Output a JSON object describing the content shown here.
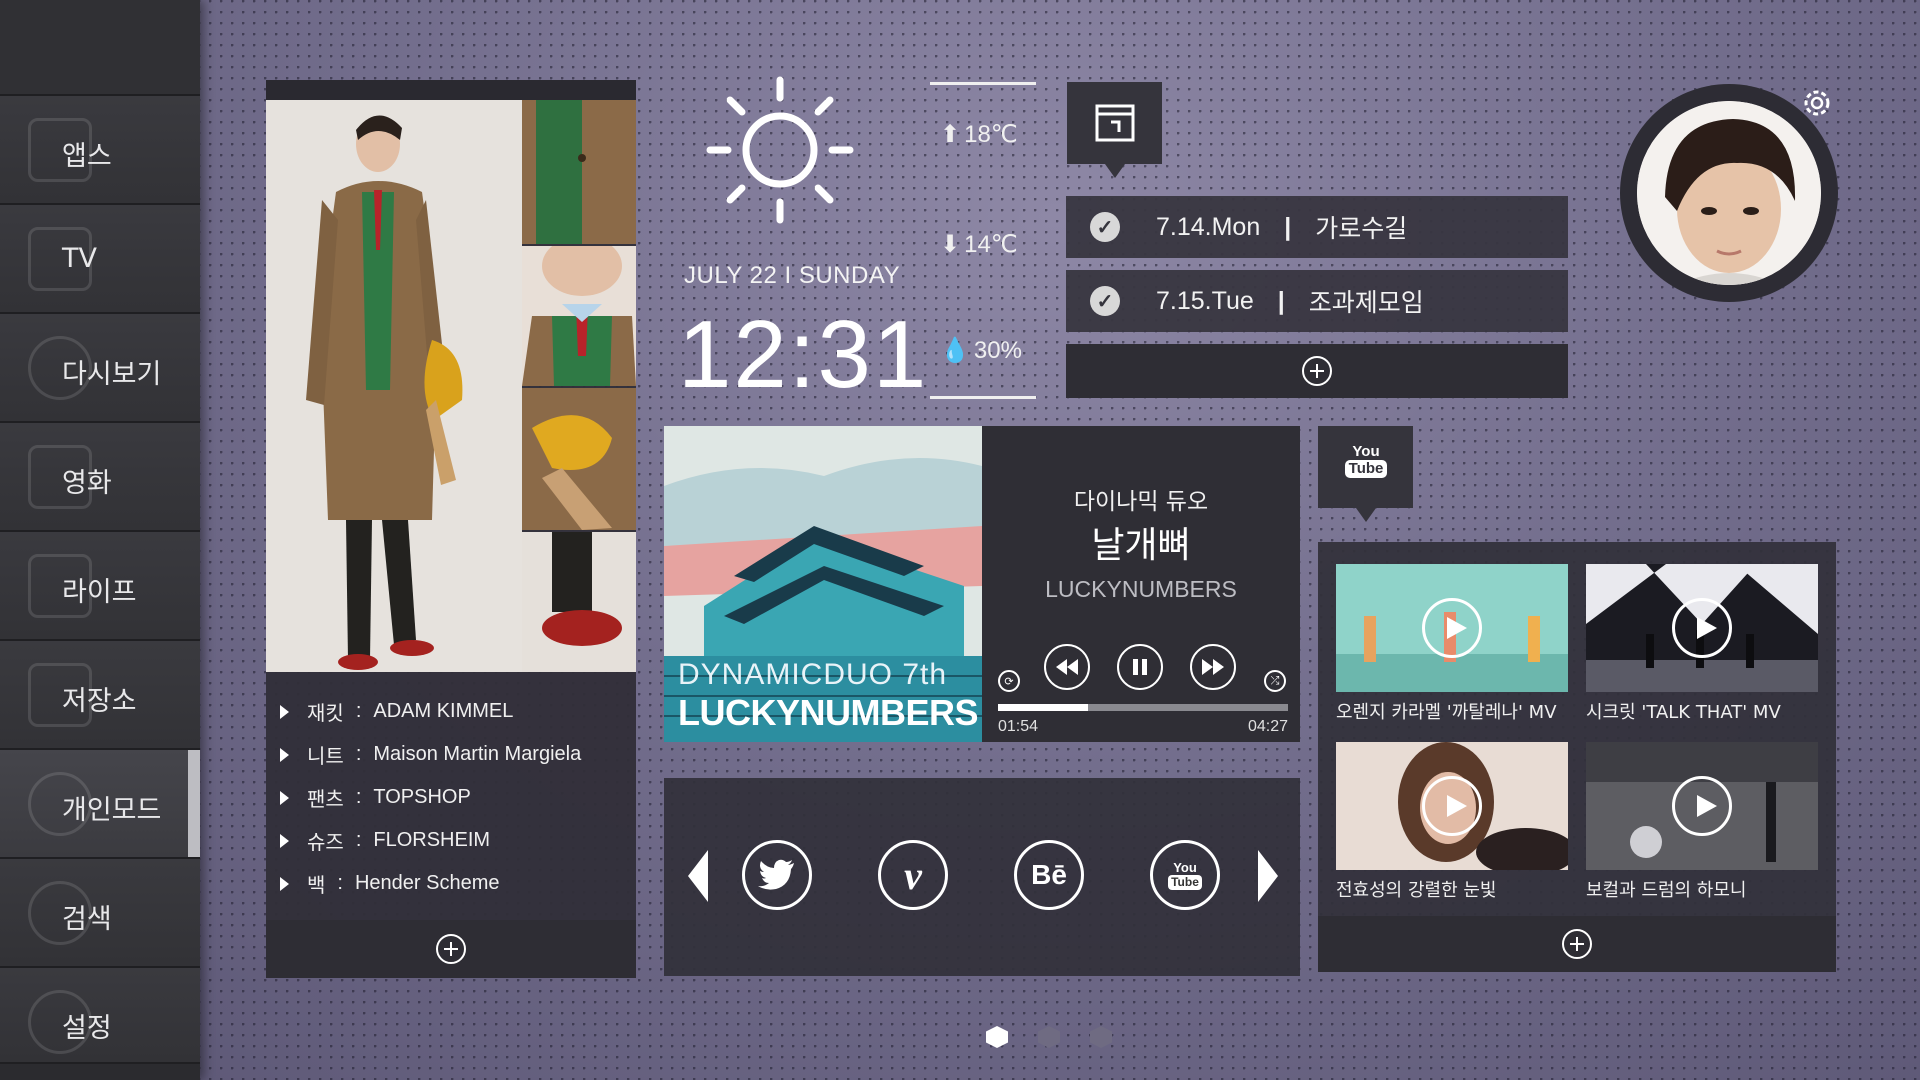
{
  "sidebar": {
    "items": [
      {
        "label": "앱스",
        "icon": "apps-icon"
      },
      {
        "label": "TV",
        "icon": "tv-icon"
      },
      {
        "label": "다시보기",
        "icon": "replay-icon"
      },
      {
        "label": "영화",
        "icon": "film-icon"
      },
      {
        "label": "라이프",
        "icon": "life-icon"
      },
      {
        "label": "저장소",
        "icon": "folder-icon"
      },
      {
        "label": "개인모드",
        "icon": "person-icon"
      },
      {
        "label": "검색",
        "icon": "search-icon"
      },
      {
        "label": "설정",
        "icon": "gear-icon"
      }
    ],
    "active_index": 6
  },
  "fashion": {
    "items": [
      {
        "key": "재킷",
        "sep": ":",
        "value": "ADAM KIMMEL"
      },
      {
        "key": "니트",
        "sep": ":",
        "value": "Maison Martin Margiela"
      },
      {
        "key": "팬츠",
        "sep": ":",
        "value": "TOPSHOP"
      },
      {
        "key": "슈즈",
        "sep": ":",
        "value": "FLORSHEIM"
      },
      {
        "key": "백",
        "sep": ":",
        "value": "Hender Scheme"
      }
    ]
  },
  "weather": {
    "date": "JULY 22 I SUNDAY",
    "time": "12:31",
    "high": "18℃",
    "low": "14℃",
    "humidity": "30%"
  },
  "calendar": {
    "events": [
      {
        "date": "7.14.Mon",
        "sep": "|",
        "title": "가로수길"
      },
      {
        "date": "7.15.Tue",
        "sep": "|",
        "title": "조과제모임"
      }
    ]
  },
  "music": {
    "album_art_line1": "DYNAMICDUO 7th",
    "album_art_line2": "LUCKYNUMBERS",
    "artist": "다이나믹 듀오",
    "song": "날개뼈",
    "album": "LUCKYNUMBERS",
    "elapsed": "01:54",
    "duration": "04:27",
    "progress": 0.31
  },
  "social": {
    "icons": [
      "twitter-icon",
      "vimeo-icon",
      "behance-icon",
      "youtube-icon"
    ],
    "behance_text": "Bē",
    "vimeo_text": "v",
    "youtube_you": "You",
    "youtube_tube": "Tube"
  },
  "youtube": {
    "tab_you": "You",
    "tab_tube": "Tube",
    "videos": [
      {
        "title": "오렌지 카라멜 '까탈레나' MV"
      },
      {
        "title": "시크릿 'TALK THAT' MV"
      },
      {
        "title": "전효성의 강렬한 눈빛"
      },
      {
        "title": "보컬과 드럼의 하모니"
      }
    ]
  },
  "pager": {
    "pages": 3,
    "active": 0
  },
  "colors": {
    "sidebar": "#2b2b2f",
    "panel": "#32303a",
    "accent": "#ffffff"
  }
}
